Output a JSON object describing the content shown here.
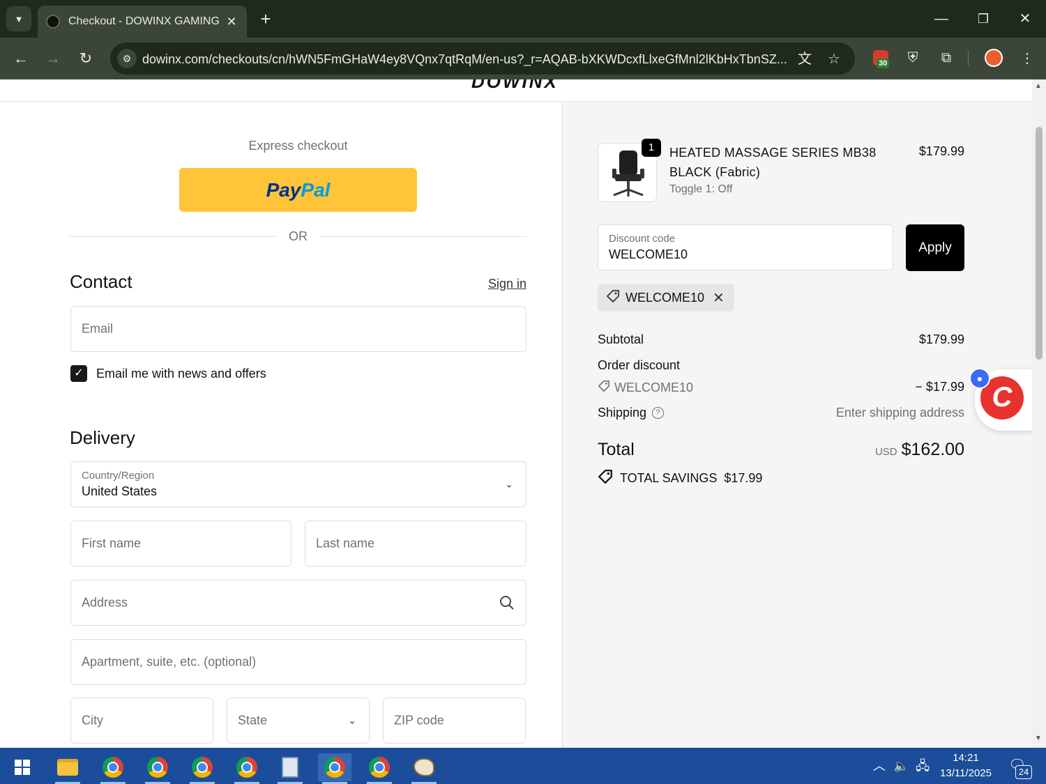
{
  "browser": {
    "tab_title": "Checkout - DOWINX GAMING C",
    "url": "dowinx.com/checkouts/cn/hWN5FmGHaW4ey8VQnx7qtRqM/en-us?_r=AQAB-bXKWDcxfLlxeGfMnl2lKbHxTbnSZ...",
    "extension_badge": "30"
  },
  "checkout": {
    "express_label": "Express checkout",
    "paypal_part1": "Pay",
    "paypal_part2": "Pal",
    "or_label": "OR",
    "contact_heading": "Contact",
    "sign_in": "Sign in",
    "email_placeholder": "Email",
    "newsletter_label": "Email me with news and offers",
    "newsletter_checked": true,
    "delivery_heading": "Delivery",
    "country_label": "Country/Region",
    "country_value": "United States",
    "first_name_placeholder": "First name",
    "last_name_placeholder": "Last name",
    "address_placeholder": "Address",
    "apartment_placeholder": "Apartment, suite, etc. (optional)",
    "city_placeholder": "City",
    "state_placeholder": "State",
    "zip_placeholder": "ZIP code"
  },
  "summary": {
    "quantity": "1",
    "product_name": "HEATED MASSAGE SERIES MB38 BLACK  (Fabric)",
    "product_variant": "Toggle 1: Off",
    "product_price": "$179.99",
    "discount_label": "Discount code",
    "discount_value": "WELCOME10",
    "apply_label": "Apply",
    "applied_code": "WELCOME10",
    "subtotal_label": "Subtotal",
    "subtotal_value": "$179.99",
    "order_discount_label": "Order discount",
    "order_discount_code": "WELCOME10",
    "order_discount_value": "− $17.99",
    "shipping_label": "Shipping",
    "shipping_value": "Enter shipping address",
    "total_label": "Total",
    "total_currency": "USD",
    "total_value": "$162.00",
    "savings_label": "TOTAL SAVINGS",
    "savings_value": "$17.99"
  },
  "taskbar": {
    "time": "14:21",
    "date": "13/11/2025",
    "notification_count": "24"
  },
  "colors": {
    "paypal_yellow": "#ffc439",
    "apply_black": "#000000",
    "taskbar_blue": "#1b4d9a",
    "chat_red": "#e8322f"
  }
}
